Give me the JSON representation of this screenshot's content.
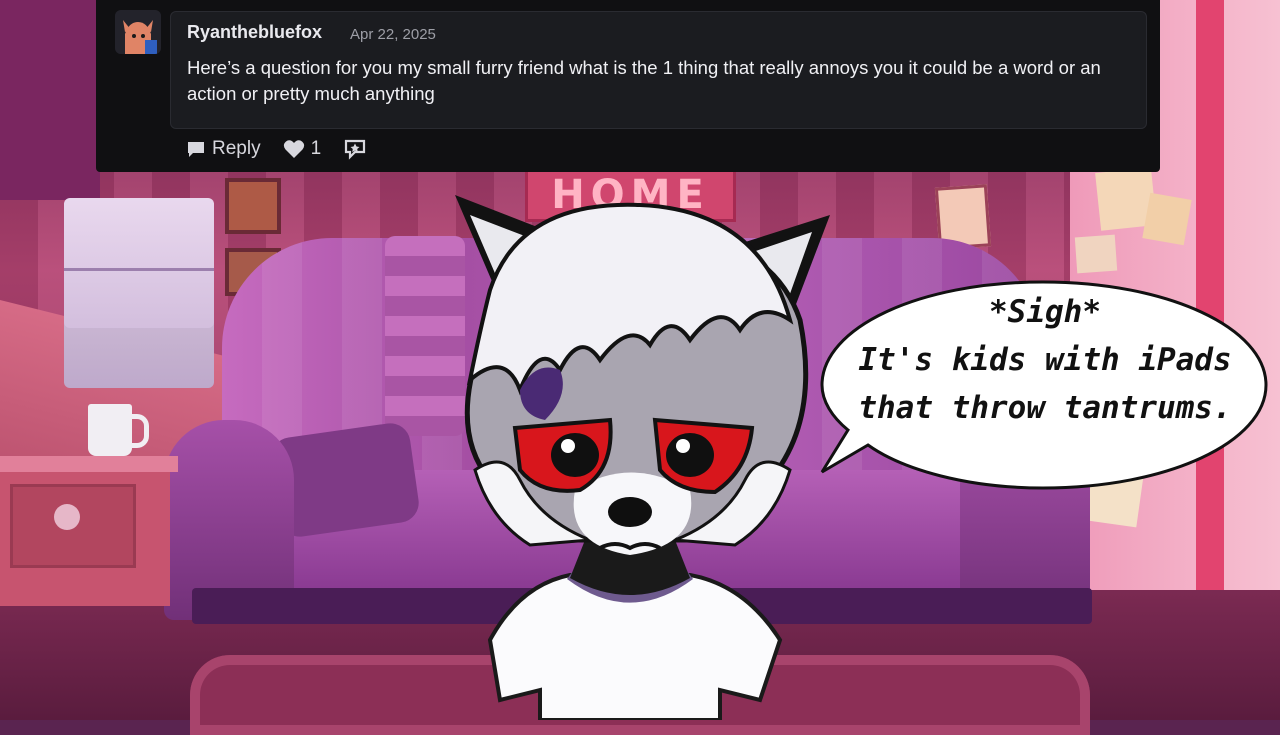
{
  "comment": {
    "username": "Ryanthebluefox",
    "date": "Apr 22, 2025",
    "body": "Here’s a question for you my small furry friend what is the 1 thing that really annoys you it could be a word or an action or pretty much anything",
    "actions": {
      "reply_label": "Reply",
      "like_count": "1"
    },
    "icons": {
      "reply": "speech-bubble-icon",
      "like": "heart-icon",
      "award": "award-icon"
    }
  },
  "scene": {
    "sign_text": "HOME"
  },
  "speech_bubble": {
    "line1": "*Sigh*",
    "line2": "It's kids with iPads",
    "line3": "that throw tantrums."
  },
  "colors": {
    "card_bg": "#101012",
    "comment_box_bg": "#1b1c20",
    "text_primary": "#f0f0f4",
    "text_muted": "#9d9ea6",
    "eye_red": "#d8161c"
  }
}
